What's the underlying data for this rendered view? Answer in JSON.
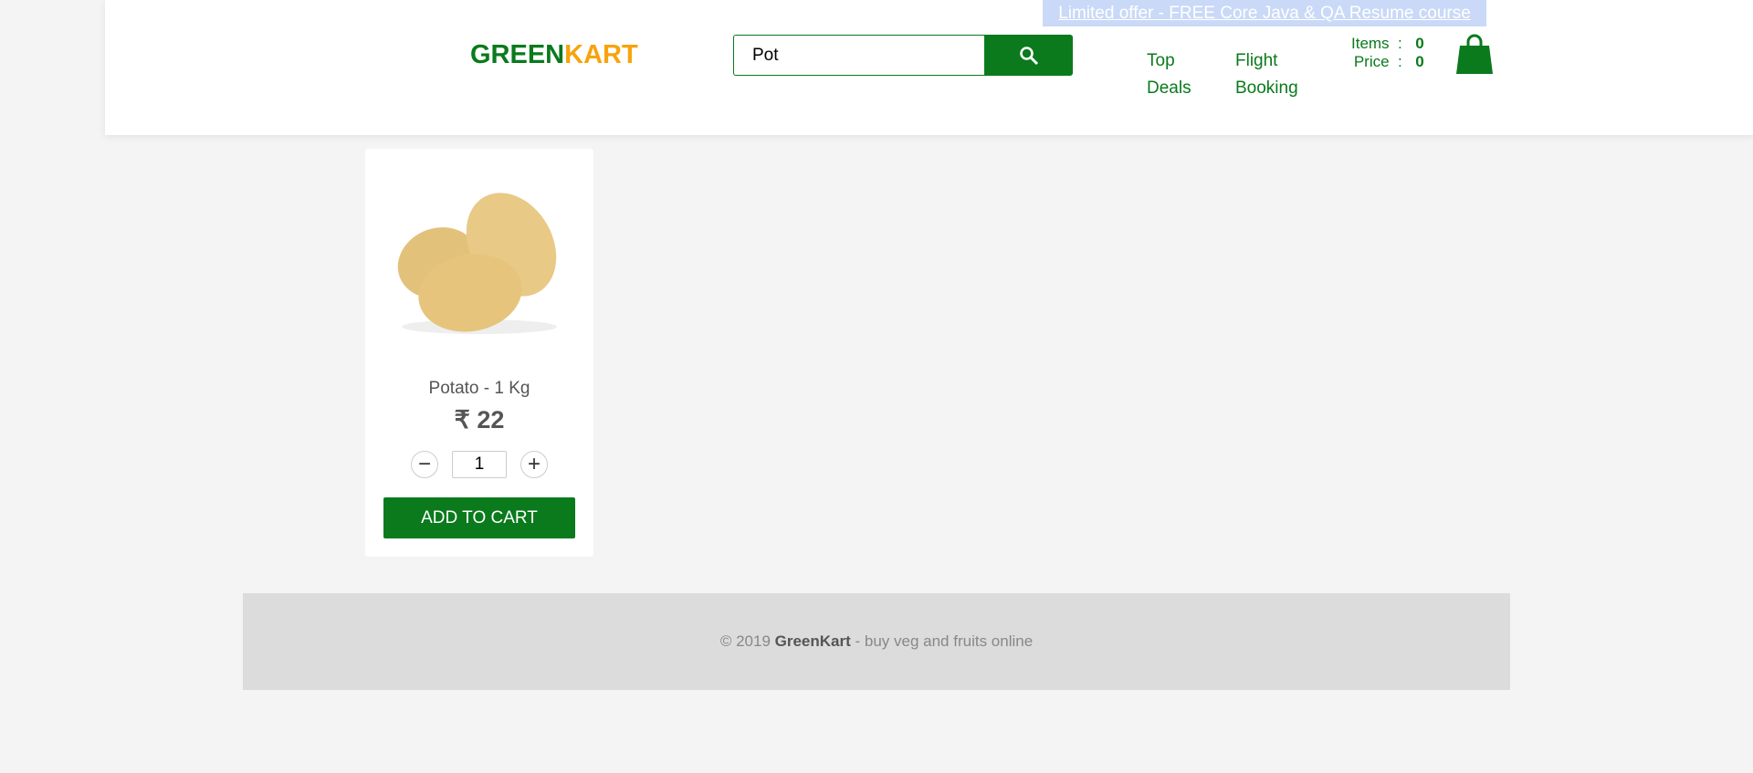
{
  "header": {
    "offer": "Limited offer - FREE Core Java & QA Resume course",
    "logo_green": "GREEN",
    "logo_kart": "KART",
    "search_value": "Pot",
    "nav": [
      {
        "label1": "Top",
        "label2": "Deals"
      },
      {
        "label1": "Flight",
        "label2": "Booking"
      }
    ],
    "items_label": "Items",
    "items_value": "0",
    "price_label": "Price",
    "price_value": "0",
    "sep": ":"
  },
  "product": {
    "name": "Potato - 1 Kg",
    "price": "₹ 22",
    "quantity": "1",
    "decrement": "−",
    "increment": "+",
    "add_label": "ADD TO CART"
  },
  "footer": {
    "prefix": "© 2019 ",
    "brand": "GreenKart",
    "suffix": " - buy veg and fruits online"
  },
  "colors": {
    "brand": "#0a7a1c",
    "accent": "#f8a30c"
  }
}
